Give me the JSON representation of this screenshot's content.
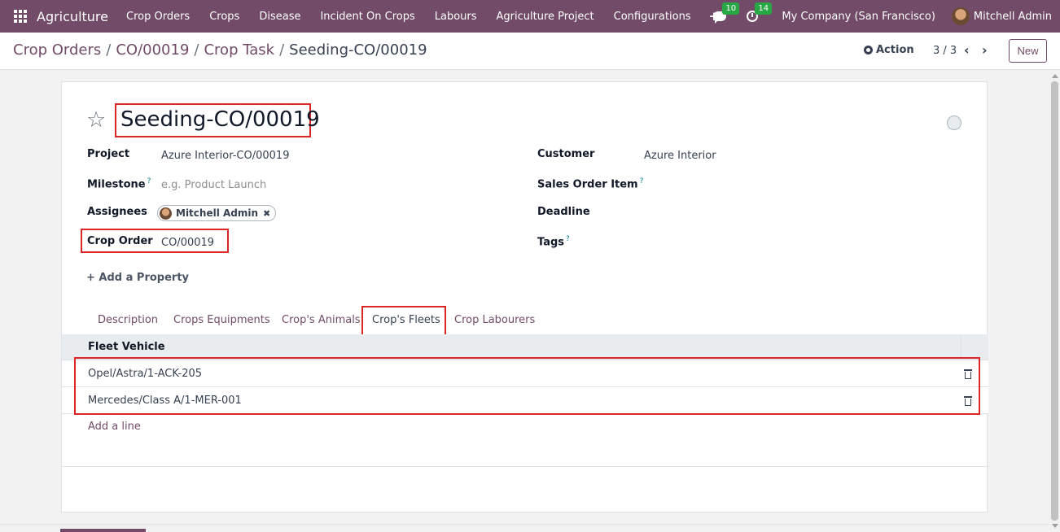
{
  "navbar": {
    "app_name": "Agriculture",
    "menu": [
      "Crop Orders",
      "Crops",
      "Disease",
      "Incident On Crops",
      "Labours",
      "Agriculture Project",
      "Configurations"
    ],
    "plus": "+",
    "messages_count": "10",
    "activities_count": "14",
    "company": "My Company (San Francisco)",
    "user": "Mitchell Admin"
  },
  "control": {
    "breadcrumb": [
      "Crop Orders",
      "CO/00019",
      "Crop Task",
      "Seeding-CO/00019"
    ],
    "breadcrumb_sep": "/",
    "action_label": "Action",
    "pager": "3 / 3",
    "prev": "‹",
    "next": "›",
    "new_label": "New"
  },
  "form": {
    "title": "Seeding-CO/00019",
    "left": {
      "project_label": "Project",
      "project_value": "Azure Interior-CO/00019",
      "milestone_label": "Milestone",
      "milestone_placeholder": "e.g. Product Launch",
      "assignees_label": "Assignees",
      "assignee": "Mitchell Admin",
      "crop_order_label": "Crop Order",
      "crop_order_value": "CO/00019"
    },
    "right": {
      "customer_label": "Customer",
      "customer_value": "Azure Interior",
      "sales_order_item_label": "Sales Order Item",
      "deadline_label": "Deadline",
      "tags_label": "Tags"
    },
    "help_mark": "?",
    "add_property": "Add a Property"
  },
  "tabs": [
    "Description",
    "Crops Equipments",
    "Crop's Animals",
    "Crop's Fleets",
    "Crop Labourers"
  ],
  "fleet_table": {
    "header": "Fleet Vehicle",
    "rows": [
      "Opel/Astra/1-ACK-205",
      "Mercedes/Class A/1-MER-001"
    ],
    "add_line": "Add a line"
  },
  "colors": {
    "brand": "#714b67",
    "highlight": "#dc2626",
    "badge": "#28a745"
  }
}
